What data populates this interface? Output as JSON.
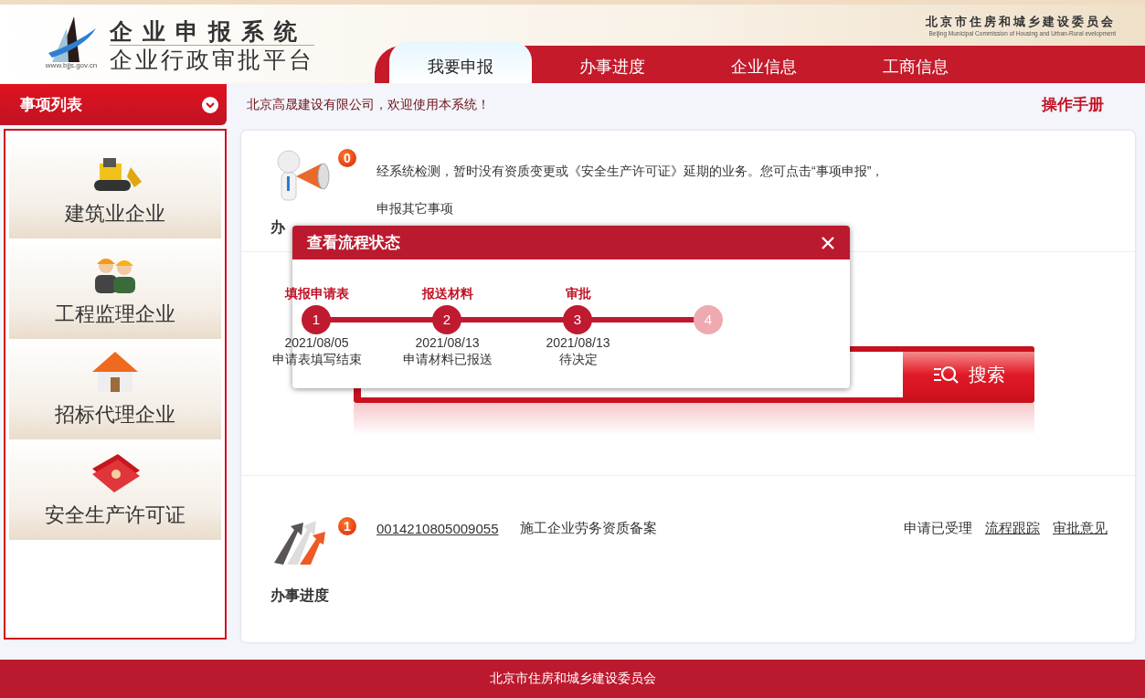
{
  "header": {
    "title_line1": "企 业 申 报 系 统",
    "title_line2": "企业行政审批平台",
    "logo_url": "www.bjjs.gov.cn",
    "org_name": "北京市住房和城乡建设委员会",
    "org_name_en": "Beijing Municipal Commission of Housing and Urban-Rural evelopment"
  },
  "nav_tabs": [
    {
      "label": "我要申报",
      "selected": true
    },
    {
      "label": "办事进度",
      "selected": false
    },
    {
      "label": "企业信息",
      "selected": false
    },
    {
      "label": "工商信息",
      "selected": false
    }
  ],
  "sidebar": {
    "title": "事项列表",
    "items": [
      {
        "label": "建筑业企业",
        "kind": "construction"
      },
      {
        "label": "工程监理企业",
        "kind": "supervision"
      },
      {
        "label": "招标代理企业",
        "kind": "bidding"
      },
      {
        "label": "安全生产许可证",
        "kind": "safety"
      }
    ]
  },
  "welcome": "北京高晟建设有限公司，欢迎使用本系统！",
  "manual_link": "操作手册",
  "notice": {
    "badge": "0",
    "label": "办",
    "message_lines": [
      "经系统检测，暂时没有资质变更或《安全生产许可证》延期的业务。您可点击“事项申报”，",
      "申报其它事项"
    ]
  },
  "search": {
    "button": "搜索"
  },
  "progress": {
    "badge": "1",
    "label": "办事进度",
    "records": [
      {
        "number": "0014210805009055",
        "title": "施工企业劳务资质备案",
        "status": "申请已受理",
        "links": [
          "流程跟踪",
          "审批意见"
        ]
      }
    ]
  },
  "modal": {
    "title": "查看流程状态",
    "steps": [
      {
        "number": "1",
        "title": "填报申请表",
        "date": "2021/08/05",
        "note": "申请表填写结束",
        "done": true
      },
      {
        "number": "2",
        "title": "报送材料",
        "date": "2021/08/13",
        "note": "申请材料已报送",
        "done": true
      },
      {
        "number": "3",
        "title": "审批",
        "date": "2021/08/13",
        "note": "待决定",
        "done": true
      },
      {
        "number": "4",
        "done": false
      }
    ]
  },
  "footer": "北京市住房和城乡建设委员会"
}
